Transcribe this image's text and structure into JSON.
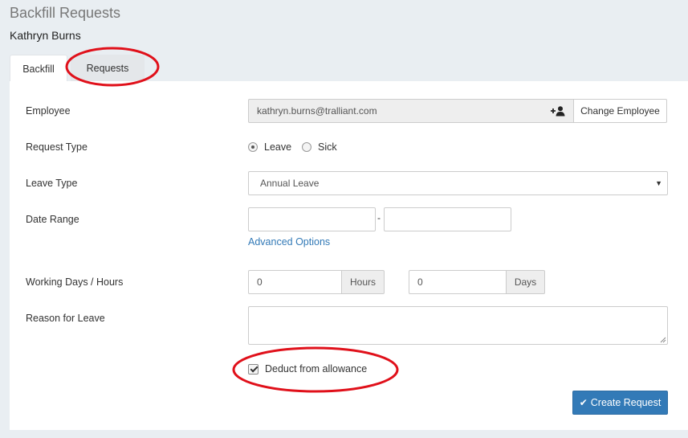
{
  "page": {
    "title": "Backfill Requests",
    "subtitle": "Kathryn Burns"
  },
  "tabs": [
    {
      "label": "Backfill",
      "active": true
    },
    {
      "label": "Requests",
      "active": false
    }
  ],
  "form": {
    "employee": {
      "label": "Employee",
      "value": "kathryn.burns@tralliant.com",
      "icon": "add-user-icon",
      "button": "Change Employee"
    },
    "request_type": {
      "label": "Request Type",
      "options": [
        "Leave",
        "Sick"
      ],
      "selected": "Leave"
    },
    "leave_type": {
      "label": "Leave Type",
      "value": "Annual Leave"
    },
    "date_range": {
      "label": "Date Range",
      "start": "",
      "end": "",
      "separator": "-",
      "advanced_link": "Advanced Options"
    },
    "working": {
      "label": "Working Days / Hours",
      "hours_value": "0",
      "hours_unit": "Hours",
      "days_value": "0",
      "days_unit": "Days"
    },
    "reason": {
      "label": "Reason for Leave",
      "value": ""
    },
    "deduct": {
      "label": "Deduct from allowance",
      "checked": true
    },
    "submit_label": "Create Request"
  },
  "colors": {
    "accent": "#337ab7",
    "annotation": "#e0101a"
  }
}
